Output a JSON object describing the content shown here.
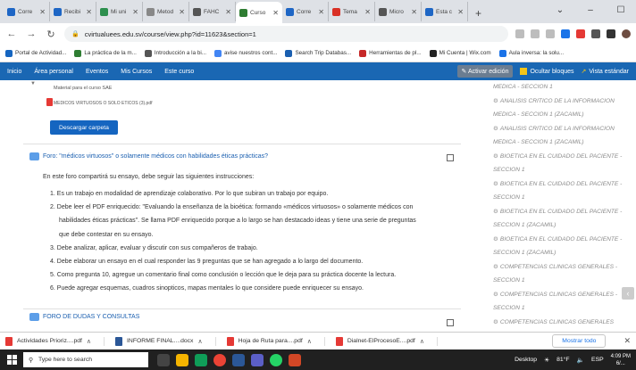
{
  "browser": {
    "tabs": [
      {
        "label": "Corre",
        "color": "#1e66c5",
        "active": false
      },
      {
        "label": "Recibi",
        "color": "#1e66c5",
        "active": false
      },
      {
        "label": "Mi uni",
        "color": "#2d8f4e",
        "active": false
      },
      {
        "label": "Metod",
        "color": "#888888",
        "active": false
      },
      {
        "label": "FAHC",
        "color": "#555555",
        "active": false
      },
      {
        "label": "Curso",
        "color": "#2f7d32",
        "active": true
      },
      {
        "label": "Corre",
        "color": "#1e66c5",
        "active": false
      },
      {
        "label": "Tema",
        "color": "#d93025",
        "active": false
      },
      {
        "label": "Micro",
        "color": "#555555",
        "active": false
      },
      {
        "label": "Esta c",
        "color": "#1e66c5",
        "active": false
      }
    ],
    "new_tab": "+",
    "url": "cvirtualuees.edu.sv/course/view.php?id=11623&section=1"
  },
  "bookmarks": [
    {
      "label": "Portal de Actividad...",
      "color": "#1565c0"
    },
    {
      "label": "La práctica de la m...",
      "color": "#2e7d32"
    },
    {
      "label": "Introducción a la bi...",
      "color": "#555555"
    },
    {
      "label": "avise nuestros cont...",
      "color": "#4285f4"
    },
    {
      "label": "Search Trip Databas...",
      "color": "#1a5fb0"
    },
    {
      "label": "Herramientas de pl...",
      "color": "#c62828"
    },
    {
      "label": "Mi Cuenta | Wix.com",
      "color": "#222222"
    },
    {
      "label": "Aula inversa: la solu...",
      "color": "#1a73e8"
    }
  ],
  "moodle_nav": {
    "items": [
      "Inicio",
      "Área personal",
      "Eventos",
      "Mis Cursos",
      "Este curso"
    ],
    "activate_edit": "Activar edición",
    "hide_blocks": "Ocultar bloques",
    "standard_view": "Vista estándar"
  },
  "content": {
    "material_label": "Material para el curso SAE",
    "pdf_file": "MEDICOS VIRTUOSOS O SOLO ETICOS (3).pdf",
    "download_button": "Descargar carpeta",
    "forum_title": "Foro: \"médicos virtuosos\" o solamente médicos con habilidades éticas prácticas?",
    "intro": "En este foro compartirá su ensayo, debe seguir las siguientes instrucciones:",
    "instructions": [
      "1. Es un trabajo en modalidad de  aprendizaje colaborativo. Por lo que subiran un trabajo por equipo.",
      "2. Debe  leer el PDF enriquecido: \"Evaluando la enseñanza de la bioética: formando «médicos virtuosos» o solamente médicos con",
      "habilidades éticas prácticas\". Se llama PDF enriquecido porque a lo largo se han destacado ideas y  tiene una serie de preguntas",
      "que debe contestar en su ensayo.",
      "3.  Debe analizar, aplicar, evaluar y discutir con sus compañeros de trabajo.",
      "4. Debe elaborar un ensayo en el cual responder las 9 preguntas que se han agregado a lo largo del documento.",
      "5. Como pregunta 10, agregue un comentario final como conclusión o lección que le deja para su práctica docente la lectura.",
      "6. Puede agregar esquemas, cuadros sinopticos, mapas mentales lo que considere puede enriquecer su ensayo."
    ],
    "forum2_title": "FORO DE DUDAS Y CONSULTAS"
  },
  "right_panel": [
    {
      "text": "MEDICA - SECCION 1",
      "icon": false
    },
    {
      "text": "ANALISIS CRITICO DE LA INFORMACION",
      "icon": true
    },
    {
      "text": "MEDICA - SECCION 1 (ZACAMIL)",
      "icon": false
    },
    {
      "text": "ANALISIS CRITICO DE LA INFORMACION",
      "icon": true
    },
    {
      "text": "MEDICA - SECCION 1 (ZACAMIL)",
      "icon": false
    },
    {
      "text": "BIOETICA EN EL CUIDADO DEL PACIENTE -",
      "icon": true
    },
    {
      "text": "SECCION 1",
      "icon": false
    },
    {
      "text": "BIOETICA EN EL CUIDADO DEL PACIENTE -",
      "icon": true
    },
    {
      "text": "SECCION 1",
      "icon": false
    },
    {
      "text": "BIOETICA EN EL CUIDADO DEL PACIENTE -",
      "icon": true
    },
    {
      "text": "SECCION 1 (ZACAMIL)",
      "icon": false
    },
    {
      "text": "BIOETICA EN EL CUIDADO DEL PACIENTE -",
      "icon": true
    },
    {
      "text": "SECCION 1 (ZACAMIL)",
      "icon": false
    },
    {
      "text": "COMPETENCIAS CLINICAS GENERALES -",
      "icon": true
    },
    {
      "text": "SECCION 1",
      "icon": false
    },
    {
      "text": "COMPETENCIAS CLINICAS GENERALES -",
      "icon": true
    },
    {
      "text": "SECCION 1",
      "icon": false
    },
    {
      "text": "COMPETENCIAS CLINICAS GENERALES",
      "icon": true
    }
  ],
  "downloads": {
    "items": [
      {
        "name": "Actividades Prioriz....pdf",
        "type": "pdf"
      },
      {
        "name": "INFORME FINAL....docx",
        "type": "word"
      },
      {
        "name": "Hoja de Ruta para....pdf",
        "type": "pdf"
      },
      {
        "name": "Dialnet-ElProcesoE....pdf",
        "type": "pdf"
      }
    ],
    "show_all": "Mostrar todo"
  },
  "taskbar": {
    "search_placeholder": "Type here to search",
    "desktop_label": "Desktop",
    "temperature": "81°F",
    "language": "ESP",
    "time": "4:09 PM",
    "date": "6/..."
  }
}
